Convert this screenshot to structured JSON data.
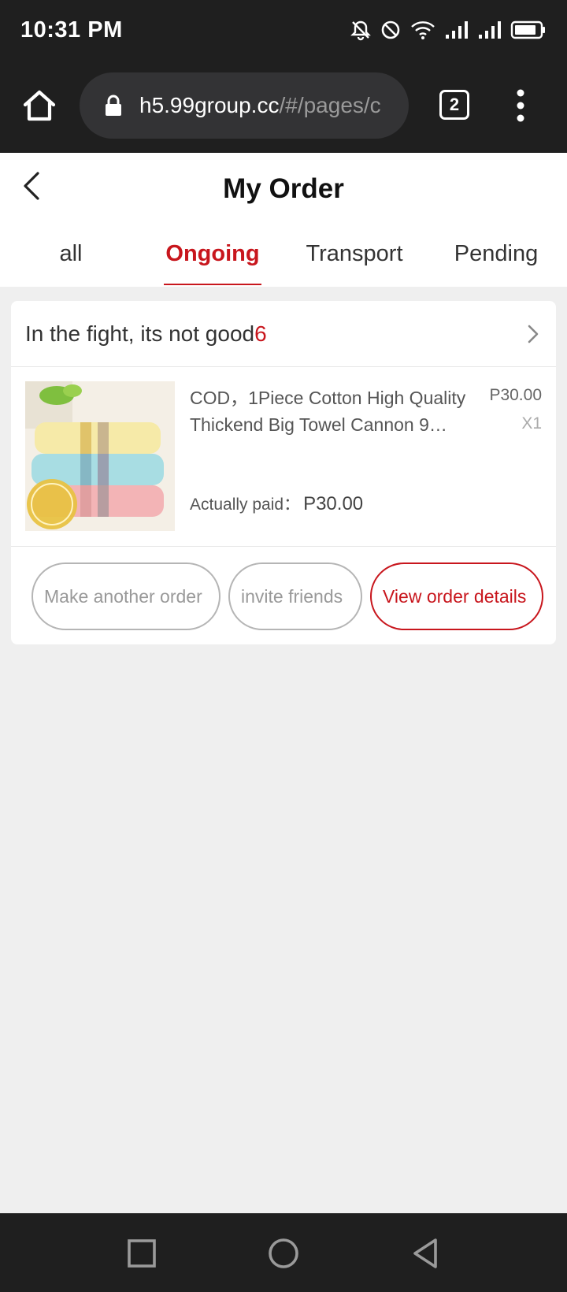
{
  "status_bar": {
    "time": "10:31 PM",
    "icons": [
      "bell-off-icon",
      "do-not-disturb-icon",
      "wifi-icon",
      "signal-icon",
      "signal-icon",
      "battery-icon"
    ]
  },
  "browser": {
    "url_main": "h5.99group.cc",
    "url_rest": "/#/pages/c",
    "tab_count": "2"
  },
  "header": {
    "title": "My Order",
    "tabs": [
      {
        "label": "all",
        "active": false
      },
      {
        "label": "Ongoing",
        "active": true
      },
      {
        "label": "Transport",
        "active": false
      },
      {
        "label": "Pending",
        "active": false
      }
    ]
  },
  "order": {
    "status_text": "In the fight, its not good",
    "status_count": "6",
    "product": {
      "name": "COD，1Piece Cotton High Quality Thickend Big Towel Cannon 9…",
      "price": "P30.00",
      "qty": "X1"
    },
    "paid_label": "Actually paid：",
    "paid_value": "P30.00",
    "buttons": {
      "reorder": "Make another order",
      "invite": "invite friends",
      "details": "View order details"
    }
  },
  "colors": {
    "accent": "#c8161d",
    "dark_bar": "#1f1f1f",
    "page_bg": "#efefef"
  }
}
